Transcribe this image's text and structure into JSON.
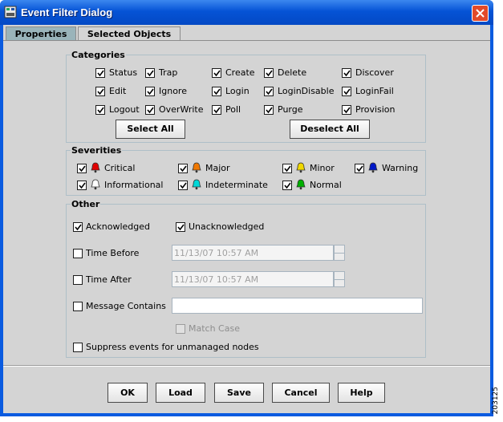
{
  "window": {
    "title": "Event Filter Dialog"
  },
  "tabs": [
    {
      "label": "Properties",
      "active": true
    },
    {
      "label": "Selected Objects",
      "active": false
    }
  ],
  "categories": {
    "title": "Categories",
    "items": [
      {
        "label": "Status",
        "checked": true
      },
      {
        "label": "Trap",
        "checked": true
      },
      {
        "label": "Create",
        "checked": true
      },
      {
        "label": "Delete",
        "checked": true
      },
      {
        "label": "Discover",
        "checked": true
      },
      {
        "label": "Edit",
        "checked": true
      },
      {
        "label": "Ignore",
        "checked": true
      },
      {
        "label": "Login",
        "checked": true
      },
      {
        "label": "LoginDisable",
        "checked": true
      },
      {
        "label": "LoginFail",
        "checked": true
      },
      {
        "label": "Logout",
        "checked": true
      },
      {
        "label": "OverWrite",
        "checked": true
      },
      {
        "label": "Poll",
        "checked": true
      },
      {
        "label": "Purge",
        "checked": true
      },
      {
        "label": "Provision",
        "checked": true
      }
    ],
    "select_all": "Select All",
    "deselect_all": "Deselect All"
  },
  "severities": {
    "title": "Severities",
    "items": [
      {
        "label": "Critical",
        "checked": true,
        "color": "#e00000"
      },
      {
        "label": "Major",
        "checked": true,
        "color": "#f07800"
      },
      {
        "label": "Minor",
        "checked": true,
        "color": "#f0d800"
      },
      {
        "label": "Warning",
        "checked": true,
        "color": "#0018c8"
      },
      {
        "label": "Informational",
        "checked": true,
        "color": "#ffffff"
      },
      {
        "label": "Indeterminate",
        "checked": true,
        "color": "#00d8d8"
      },
      {
        "label": "Normal",
        "checked": true,
        "color": "#00b000"
      }
    ]
  },
  "other": {
    "title": "Other",
    "acknowledged": {
      "label": "Acknowledged",
      "checked": true
    },
    "unacknowledged": {
      "label": "Unacknowledged",
      "checked": true
    },
    "time_before": {
      "label": "Time Before",
      "checked": false,
      "value": "11/13/07 10:57 AM"
    },
    "time_after": {
      "label": "Time After",
      "checked": false,
      "value": "11/13/07 10:57 AM"
    },
    "message_contains": {
      "label": "Message Contains",
      "checked": false,
      "value": ""
    },
    "match_case": {
      "label": "Match Case",
      "checked": false
    },
    "suppress": {
      "label": "Suppress events for unmanaged nodes",
      "checked": false
    }
  },
  "buttons": {
    "ok": "OK",
    "load": "Load",
    "save": "Save",
    "cancel": "Cancel",
    "help": "Help"
  },
  "figure_id": "203125",
  "colors": {
    "titlebar": "#0553d6",
    "dialog_bg": "#d4d4d4",
    "tab_active": "#9ab4ba",
    "close": "#e24a2a"
  }
}
